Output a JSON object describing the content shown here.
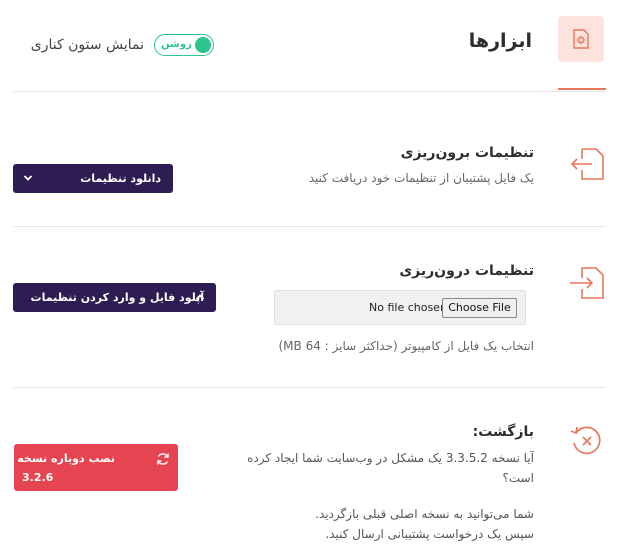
{
  "header": {
    "title": "ابزارها",
    "sidebar_label": "نمایش ستون کناری",
    "toggle_state": "روشن",
    "tool_icon": "gear-document-icon"
  },
  "sections": {
    "export": {
      "title": "تنظیمات برون‌ریزی",
      "description": "یک فایل پشتیبان از تنظیمات خود دریافت کنید",
      "button_label": "دانلود تنظیمات",
      "icon": "export-document-icon"
    },
    "import": {
      "title": "تنظیمات درون‌ریزی",
      "button_label": "آپلود فایل و وارد کردن تنظیمات",
      "file_status": "No file chosen",
      "file_button": "Choose File",
      "hint": "انتخاب یک فایل از کامپیوتر (حداکثر سایز : 64 MB)",
      "icon": "import-document-icon"
    },
    "rollback": {
      "title": "بازگشت:",
      "line1": "آیا نسخه 3.3.5.2 یک مشکل در وب‌سایت شما ایجاد کرده",
      "line2": "است؟",
      "line3": "شما می‌توانید به نسخه اصلی قبلی بازگردید.",
      "line4": "سپس یک درخواست پشتیبانی ارسال کنید.",
      "button_label": "نصب دوباره نسخه",
      "button_version": "3.2.6",
      "icon": "rollback-icon"
    }
  },
  "colors": {
    "accent": "#e8765a",
    "dark_button": "#2d1d52",
    "danger_button": "#e54550",
    "toggle": "#2bc48a"
  }
}
